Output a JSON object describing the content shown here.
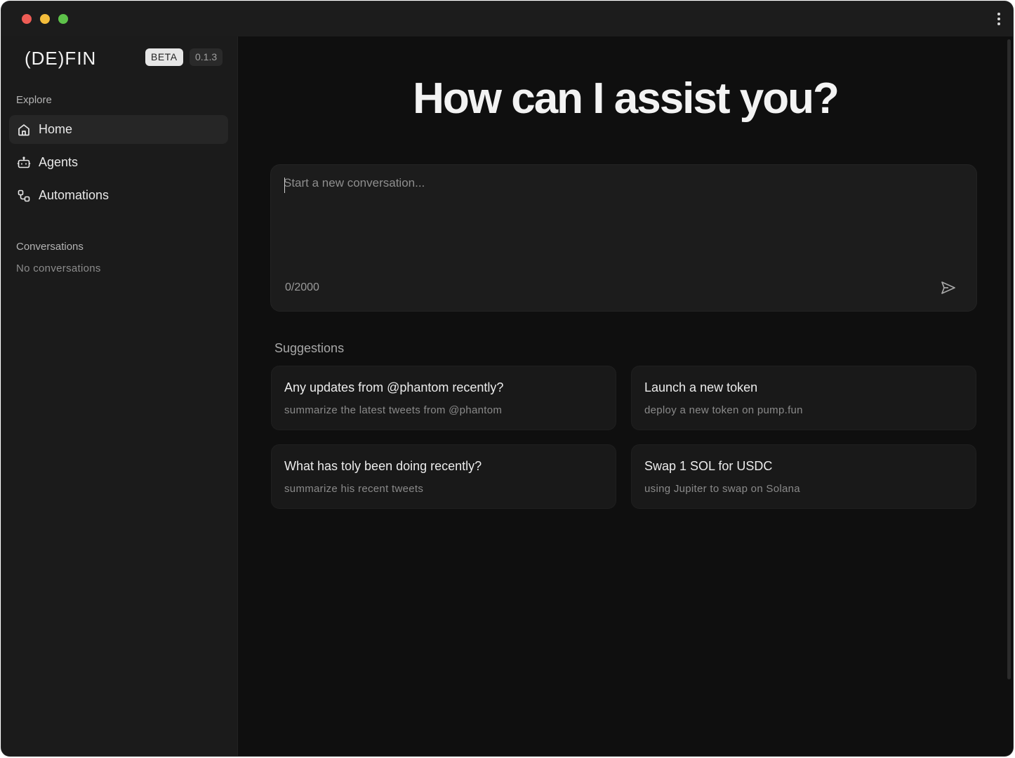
{
  "window": {
    "titlebar": {
      "buttons": [
        "close",
        "minimize",
        "zoom"
      ],
      "menu_icon": "more-vertical-icon"
    }
  },
  "sidebar": {
    "logo": "(DE)FIN",
    "badge": "BETA",
    "version": "0.1.3",
    "explore_label": "Explore",
    "nav": [
      {
        "label": "Home",
        "icon": "home-icon",
        "active": true
      },
      {
        "label": "Agents",
        "icon": "robot-icon",
        "active": false
      },
      {
        "label": "Automations",
        "icon": "workflow-icon",
        "active": false
      }
    ],
    "conversations_label": "Conversations",
    "conversations_empty": "No conversations"
  },
  "main": {
    "heading": "How can I assist you?",
    "composer": {
      "placeholder": "Start a new conversation...",
      "value": "",
      "counter": "0/2000",
      "send_icon": "send-icon"
    },
    "suggestions_label": "Suggestions",
    "suggestions": [
      {
        "title": "Any updates from @phantom recently?",
        "subtitle": "summarize the latest tweets from @phantom"
      },
      {
        "title": "Launch a new token",
        "subtitle": "deploy a new token on pump.fun"
      },
      {
        "title": "What has toly been doing recently?",
        "subtitle": "summarize his recent tweets"
      },
      {
        "title": "Swap 1 SOL for USDC",
        "subtitle": "using Jupiter to swap on Solana"
      }
    ]
  },
  "colors": {
    "background": "#0f0f0f",
    "sidebar": "#1b1b1b",
    "card": "#191919",
    "traffic_red": "#ee5c55",
    "traffic_yellow": "#f4bd3b",
    "traffic_green": "#5ec24a"
  }
}
